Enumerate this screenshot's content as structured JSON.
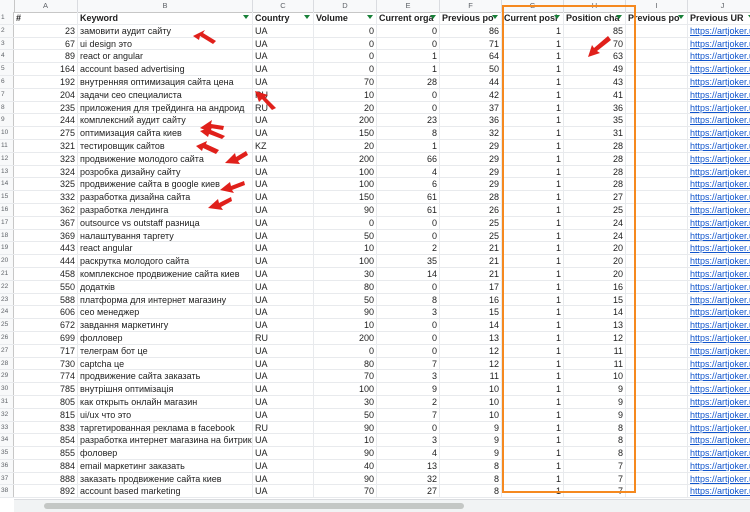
{
  "column_letters": [
    "A",
    "B",
    "C",
    "D",
    "E",
    "F",
    "G",
    "H",
    "I",
    "J"
  ],
  "headers": [
    "#",
    "Keyword",
    "Country",
    "Volume",
    "Current orga",
    "Previous po",
    "Current posi",
    "Position cha",
    "Previous po",
    "Previous UR"
  ],
  "row_numbers": [
    "1",
    "2",
    "3",
    "4",
    "5",
    "6",
    "7",
    "8",
    "9",
    "10",
    "11",
    "12",
    "13",
    "14",
    "15",
    "16",
    "17",
    "18",
    "19",
    "20",
    "21",
    "22",
    "23",
    "24",
    "25",
    "26",
    "27",
    "28",
    "29",
    "30",
    "31",
    "32",
    "33",
    "34",
    "35",
    "36",
    "37",
    "38"
  ],
  "rows": [
    [
      "23",
      "замовити аудит сайту",
      "UA",
      "0",
      "0",
      "86",
      "1",
      "85",
      "",
      "https://artjoker.u"
    ],
    [
      "67",
      "ui design это",
      "UA",
      "0",
      "0",
      "71",
      "1",
      "70",
      "",
      "https://artjoker.u"
    ],
    [
      "89",
      "react or angular",
      "UA",
      "0",
      "1",
      "64",
      "1",
      "63",
      "",
      "https://artjoker.u"
    ],
    [
      "164",
      "account based advertising",
      "UA",
      "0",
      "1",
      "50",
      "1",
      "49",
      "",
      "https://artjoker.u"
    ],
    [
      "192",
      "внутренняя оптимизация сайта цена",
      "UA",
      "70",
      "28",
      "44",
      "1",
      "43",
      "",
      "https://artjoker.u"
    ],
    [
      "204",
      "задачи сео специалиста",
      "RU",
      "10",
      "0",
      "42",
      "1",
      "41",
      "",
      "https://artjoker.u"
    ],
    [
      "235",
      "приложения для трейдинга на андроид",
      "RU",
      "20",
      "0",
      "37",
      "1",
      "36",
      "",
      "https://artjoker.u"
    ],
    [
      "244",
      "комплексний аудит сайту",
      "UA",
      "200",
      "23",
      "36",
      "1",
      "35",
      "",
      "https://artjoker.u"
    ],
    [
      "275",
      "оптимизация сайта киев",
      "UA",
      "150",
      "8",
      "32",
      "1",
      "31",
      "",
      "https://artjoker.u"
    ],
    [
      "321",
      "тестировщик сайтов",
      "KZ",
      "20",
      "1",
      "29",
      "1",
      "28",
      "",
      "https://artjoker.u"
    ],
    [
      "323",
      "продвижение молодого сайта",
      "UA",
      "200",
      "66",
      "29",
      "1",
      "28",
      "",
      "https://artjoker.u"
    ],
    [
      "324",
      "розробка дизайну сайту",
      "UA",
      "100",
      "4",
      "29",
      "1",
      "28",
      "",
      "https://artjoker.u"
    ],
    [
      "325",
      "продвижение сайта в google киев",
      "UA",
      "100",
      "6",
      "29",
      "1",
      "28",
      "",
      "https://artjoker.u"
    ],
    [
      "332",
      "разработка дизайна сайта",
      "UA",
      "150",
      "61",
      "28",
      "1",
      "27",
      "",
      "https://artjoker.u"
    ],
    [
      "362",
      "разработка лендинга",
      "UA",
      "90",
      "61",
      "26",
      "1",
      "25",
      "",
      "https://artjoker.u"
    ],
    [
      "367",
      "outsource vs outstaff разница",
      "UA",
      "0",
      "0",
      "25",
      "1",
      "24",
      "",
      "https://artjoker.u"
    ],
    [
      "369",
      "налаштування таргету",
      "UA",
      "50",
      "0",
      "25",
      "1",
      "24",
      "",
      "https://artjoker.u"
    ],
    [
      "443",
      "react angular",
      "UA",
      "10",
      "2",
      "21",
      "1",
      "20",
      "",
      "https://artjoker.u"
    ],
    [
      "444",
      "раскрутка молодого сайта",
      "UA",
      "100",
      "35",
      "21",
      "1",
      "20",
      "",
      "https://artjoker.u"
    ],
    [
      "458",
      "комплексное продвижение сайта киев",
      "UA",
      "30",
      "14",
      "21",
      "1",
      "20",
      "",
      "https://artjoker.u"
    ],
    [
      "550",
      "додатків",
      "UA",
      "80",
      "0",
      "17",
      "1",
      "16",
      "",
      "https://artjoker.u"
    ],
    [
      "588",
      "платформа для интернет магазину",
      "UA",
      "50",
      "8",
      "16",
      "1",
      "15",
      "",
      "https://artjoker.u"
    ],
    [
      "606",
      "сео менеджер",
      "UA",
      "90",
      "3",
      "15",
      "1",
      "14",
      "",
      "https://artjoker.u"
    ],
    [
      "672",
      "завдання маркетингу",
      "UA",
      "10",
      "0",
      "14",
      "1",
      "13",
      "",
      "https://artjoker.u"
    ],
    [
      "699",
      "фолловер",
      "RU",
      "200",
      "0",
      "13",
      "1",
      "12",
      "",
      "https://artjoker.u"
    ],
    [
      "717",
      "телеграм бот це",
      "UA",
      "0",
      "0",
      "12",
      "1",
      "11",
      "",
      "https://artjoker.u"
    ],
    [
      "730",
      "captcha це",
      "UA",
      "80",
      "7",
      "12",
      "1",
      "11",
      "",
      "https://artjoker.u"
    ],
    [
      "774",
      "продвижение сайта заказать",
      "UA",
      "70",
      "3",
      "11",
      "1",
      "10",
      "",
      "https://artjoker.u"
    ],
    [
      "785",
      "внутрішня оптимізація",
      "UA",
      "100",
      "9",
      "10",
      "1",
      "9",
      "",
      "https://artjoker.u"
    ],
    [
      "805",
      "как открыть онлайн магазин",
      "UA",
      "30",
      "2",
      "10",
      "1",
      "9",
      "",
      "https://artjoker.u"
    ],
    [
      "815",
      "ui/ux что это",
      "UA",
      "50",
      "7",
      "10",
      "1",
      "9",
      "",
      "https://artjoker.u"
    ],
    [
      "838",
      "таргетированная реклама в facebook",
      "RU",
      "90",
      "0",
      "9",
      "1",
      "8",
      "",
      "https://artjoker.u"
    ],
    [
      "854",
      "разработка интернет магазина на битрикс",
      "UA",
      "10",
      "3",
      "9",
      "1",
      "8",
      "",
      "https://artjoker.u"
    ],
    [
      "855",
      "фоловер",
      "UA",
      "90",
      "4",
      "9",
      "1",
      "8",
      "",
      "https://artjoker.u"
    ],
    [
      "884",
      "email маркетинг заказать",
      "UA",
      "40",
      "13",
      "8",
      "1",
      "7",
      "",
      "https://artjoker.u"
    ],
    [
      "888",
      "заказать продвижение сайта киев",
      "UA",
      "90",
      "32",
      "8",
      "1",
      "7",
      "",
      "https://artjoker.u"
    ],
    [
      "892",
      "account based marketing",
      "UA",
      "70",
      "27",
      "8",
      "1",
      "7",
      "",
      "https://artjoker.u"
    ]
  ],
  "colors": {
    "highlight_box": "#f5891f",
    "arrows": "#e0201b",
    "link": "#1155cc",
    "filter_icon": "#188038"
  },
  "icons": {
    "filter": "filter-icon",
    "arrow": "red-arrow-annotation"
  }
}
